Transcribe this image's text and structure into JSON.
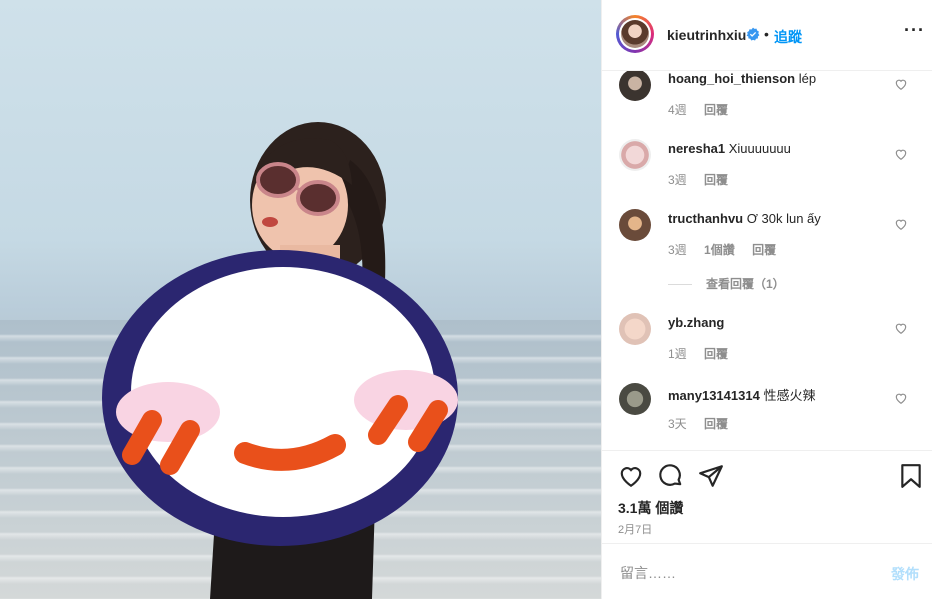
{
  "header": {
    "username": "kieutrinhxiu",
    "separator": "•",
    "follow_label": "追蹤",
    "more_label": "···"
  },
  "comments": [
    {
      "username": "hoang_hoi_thienson",
      "text": "lép",
      "time": "4週",
      "reply_label": "回覆"
    },
    {
      "username": "neresha1",
      "text": "Xiuuuuuuu",
      "time": "3週",
      "reply_label": "回覆"
    },
    {
      "username": "tructhanhvu",
      "text": "Ơ 30k lun ấy",
      "time": "3週",
      "likes": "1個讚",
      "reply_label": "回覆",
      "view_replies": "查看回覆（1）"
    },
    {
      "username": "yb.zhang",
      "text": "",
      "time": "1週",
      "reply_label": "回覆"
    },
    {
      "username": "many13141314",
      "text": "性感火辣",
      "time": "3天",
      "reply_label": "回覆"
    }
  ],
  "stats": {
    "views": "3.1萬 個讚",
    "date": "2月7日"
  },
  "add_comment": {
    "placeholder": "留言……",
    "post_label": "發佈"
  },
  "colors": {
    "accent": "#0095f6",
    "sticker_navy": "#2b2670",
    "sticker_orange": "#e9501b",
    "sticker_pink": "#f9d4e3"
  },
  "icons": [
    "verified-icon",
    "heart-icon",
    "comment-icon",
    "share-icon",
    "bookmark-icon"
  ]
}
